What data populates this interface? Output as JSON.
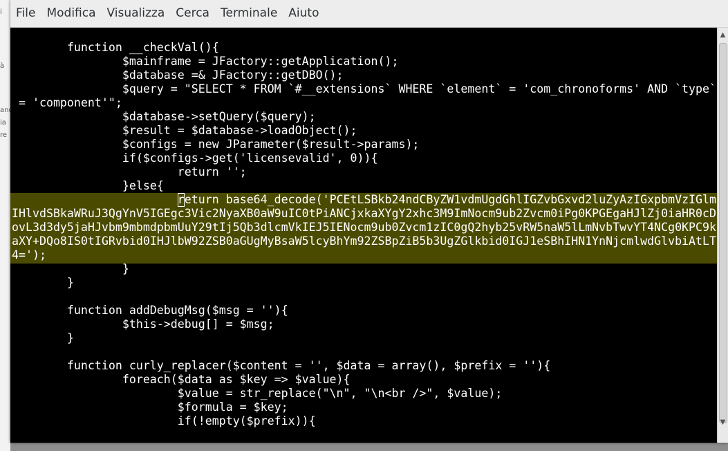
{
  "background_window": {
    "fragments": [
      "i",
      "à",
      "and",
      "ia",
      "re"
    ]
  },
  "menubar": {
    "items": [
      "File",
      "Modifica",
      "Visualizza",
      "Cerca",
      "Terminale",
      "Aiuto"
    ]
  },
  "terminal": {
    "lines": [
      "        function __checkVal(){",
      "                $mainframe = JFactory::getApplication();",
      "                $database =& JFactory::getDBO();",
      "                $query = \"SELECT * FROM `#__extensions` WHERE `element` = 'com_chronoforms' AND `type`",
      " = 'component'\";",
      "                $database->setQuery($query);",
      "                $result = $database->loadObject();",
      "                $configs = new JParameter($result->params);",
      "                if($configs->get('licensevalid', 0)){",
      "                        return '';",
      "                }else{",
      "r",
      "IHlvdSBkaWRuJ3QgYnV5IGEgc3Vic2NyaXB0aW9uIC0tPiANCjxkaXYgY2xhc3M9ImNocm9ub2Zvcm0iPg0KPGEgaHJlZj0iaHR0cD",
      "ovL3d3dy5jaHJvbm9mbmdpbmUuY29tIj5Qb3dlcmVkIEJ5IENocm9ub0Zvcm1zIC0gQ2hyb25vRW5naW5lLmNvbTwvYT4NCg0KPC9k",
      "aXY+DQo8IS0tIGRvbid0IHJlbW92ZSB0aGUgMyBsaW5lcyBhYm92ZSBpZiB5b3UgZGlkbid0IGJ1eSBhIHN1YnNjcmlwdGlvbiAtLT",
      "4=');",
      "                }",
      "        }",
      "",
      "        function addDebugMsg($msg = ''){",
      "                $this->debug[] = $msg;",
      "        }",
      "",
      "        function curly_replacer($content = '', $data = array(), $prefix = ''){",
      "                foreach($data as $key => $value){",
      "                        $value = str_replace(\"\\n\", \"\\n<br />\", $value);",
      "                        $formula = $key;",
      "                        if(!empty($prefix)){"
    ],
    "cursor_line": {
      "indent": "                        ",
      "cursor_char": "r",
      "rest": "eturn base64_decode('PCEtLSBkb24ndCByZW1vdmUgdGhlIGZvbGxvd2luZyAzIGxpbmVzIGlm"
    },
    "highlight_color": "#4a4a00"
  }
}
